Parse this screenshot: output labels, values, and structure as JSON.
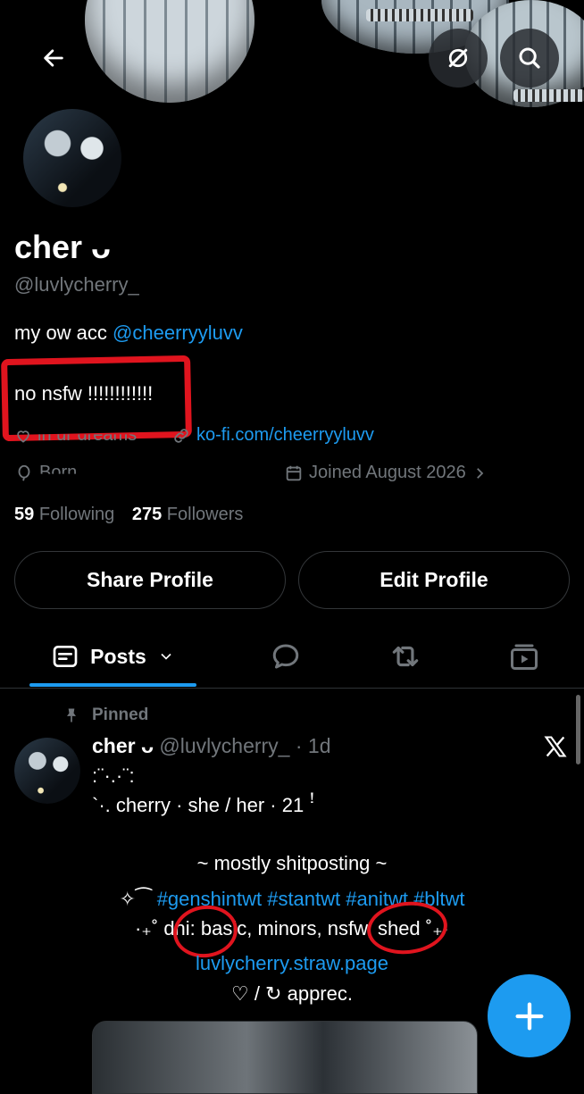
{
  "profile": {
    "display_name": "cher ᴗ",
    "handle": "@luvlycherry_",
    "bio_line1_prefix": "my ow acc ",
    "bio_line1_mention": "@cheerryyluvv",
    "bio_line2": "no nsfw !!!!!!!!!!!!",
    "location_partial": "in ur dreams",
    "website": "ko-fi.com/cheerryyluvv",
    "birth_partial": "Born",
    "joined": "Joined August 2026",
    "following_count": "59",
    "following_label": "Following",
    "followers_count": "275",
    "followers_label": "Followers"
  },
  "buttons": {
    "share_profile": "Share Profile",
    "edit_profile": "Edit Profile"
  },
  "tabs": {
    "posts_label": "Posts"
  },
  "pinned_post": {
    "pinned_label": "Pinned",
    "author_name": "cher ᴗ",
    "author_handle": "@luvlycherry_",
    "time": "· 1d",
    "line1": ":¨·.·¨:",
    "line2": "`·. cherry · she / her · 21 ꜝ",
    "line3": "~ mostly shitposting ~",
    "line4_prefix": "✧⁀",
    "line4_tags": "#genshintwt #stantwt #anitwt #bltwt",
    "line5": "·₊˚ dni: basic, minors, nsfw, shed ˚₊·",
    "line6_link": "luvlycherry.straw.page",
    "line7": "♡ / ↻ apprec."
  },
  "colors": {
    "accent": "#1d9bf0",
    "annotation_red": "#e0141e",
    "muted": "#71767b"
  }
}
